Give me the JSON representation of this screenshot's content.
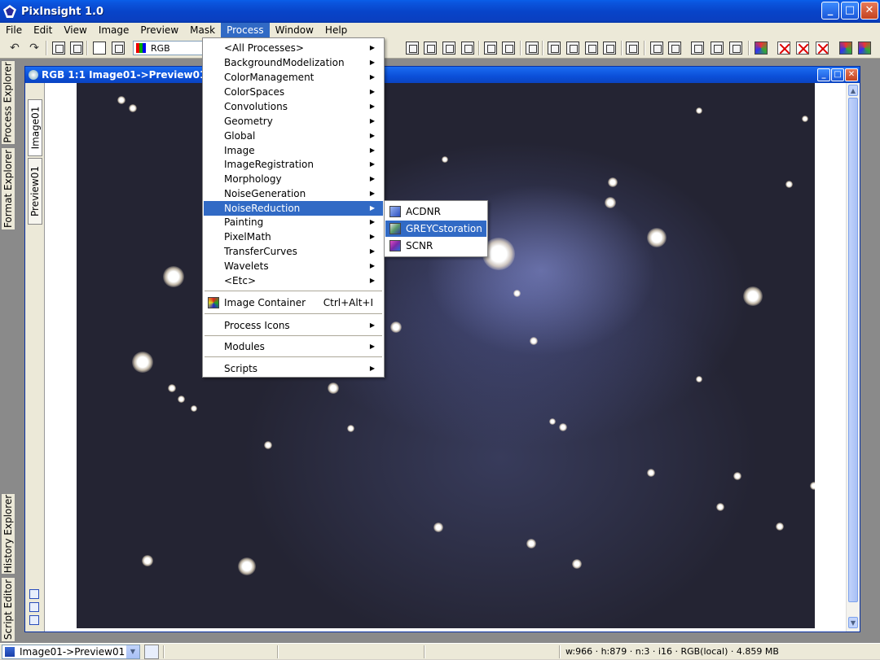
{
  "window": {
    "title": "PixInsight 1.0",
    "buttons": {
      "minimize": "_",
      "maximize": "□",
      "close": "✕"
    }
  },
  "menubar": [
    "File",
    "Edit",
    "View",
    "Image",
    "Preview",
    "Mask",
    "Process",
    "Window",
    "Help"
  ],
  "active_menu": "Process",
  "toolbar": {
    "color_space": "RGB"
  },
  "left_panels": [
    "Process Explorer",
    "Format Explorer",
    "History Explorer",
    "Script Editor"
  ],
  "image_window": {
    "title": "RGB 1:1 Image01->Preview01 E:/",
    "view_tabs": [
      "Image01",
      "Preview01"
    ]
  },
  "process_menu": {
    "items": [
      {
        "label": "<All Processes>",
        "submenu": true
      },
      {
        "label": "BackgroundModelization",
        "submenu": true
      },
      {
        "label": "ColorManagement",
        "submenu": true
      },
      {
        "label": "ColorSpaces",
        "submenu": true
      },
      {
        "label": "Convolutions",
        "submenu": true
      },
      {
        "label": "Geometry",
        "submenu": true
      },
      {
        "label": "Global",
        "submenu": true
      },
      {
        "label": "Image",
        "submenu": true
      },
      {
        "label": "ImageRegistration",
        "submenu": true
      },
      {
        "label": "Morphology",
        "submenu": true
      },
      {
        "label": "NoiseGeneration",
        "submenu": true
      },
      {
        "label": "NoiseReduction",
        "submenu": true,
        "highlighted": true
      },
      {
        "label": "Painting",
        "submenu": true
      },
      {
        "label": "PixelMath",
        "submenu": true
      },
      {
        "label": "TransferCurves",
        "submenu": true
      },
      {
        "label": "Wavelets",
        "submenu": true
      },
      {
        "label": "<Etc>",
        "submenu": true
      }
    ],
    "image_container": {
      "label": "Image Container",
      "shortcut": "Ctrl+Alt+I"
    },
    "process_icons": "Process Icons",
    "modules": "Modules",
    "scripts": "Scripts"
  },
  "noise_reduction_submenu": [
    {
      "label": "ACDNR",
      "icon": "acdnr-icon",
      "color": "#6a8ad8"
    },
    {
      "label": "GREYCstoration",
      "icon": "greycstoration-icon",
      "color": "#5a9a6a",
      "highlighted": true
    },
    {
      "label": "SCNR",
      "icon": "scnr-icon",
      "color": "#c23aa8"
    }
  ],
  "statusbar": {
    "view": "Image01->Preview01",
    "info": "w:966 · h:879 · n:3 · i16 · RGB(local) · 4.859 MB"
  },
  "colors": {
    "titlebar": "#0a46c8",
    "highlight": "#316ac5",
    "chrome": "#ece9d8"
  }
}
